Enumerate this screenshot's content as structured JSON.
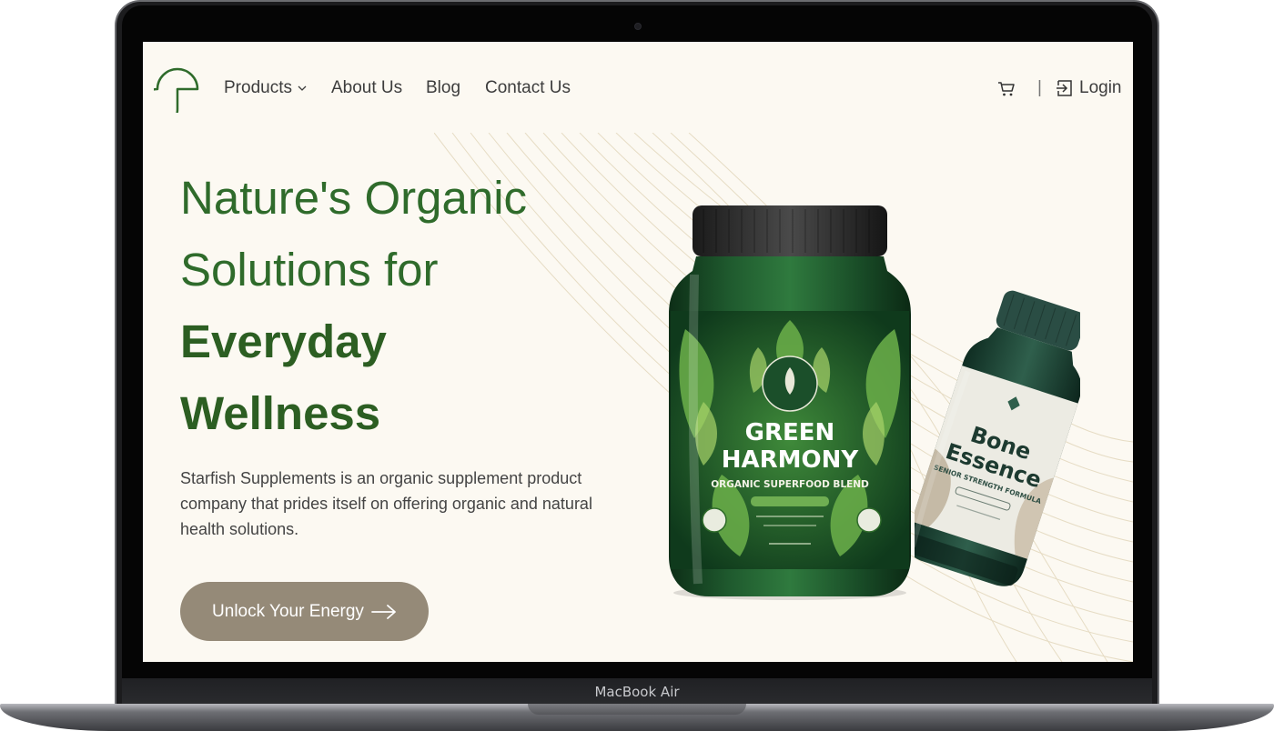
{
  "device": {
    "label": "MacBook Air"
  },
  "nav": {
    "items": [
      {
        "label": "Products",
        "has_dropdown": true
      },
      {
        "label": "About Us"
      },
      {
        "label": "Blog"
      },
      {
        "label": "Contact Us"
      }
    ],
    "divider": "|",
    "login_label": "Login"
  },
  "hero": {
    "title_lines": [
      "Nature's Organic",
      "Solutions for",
      "Everyday",
      "Wellness"
    ],
    "description": "Starfish Supplements is an organic supplement product company that prides itself on offering organic and natural health solutions.",
    "cta_label": "Unlock Your Energy"
  },
  "products": {
    "main": {
      "name_line1": "GREEN",
      "name_line2": "HARMONY",
      "subtitle": "ORGANIC SUPERFOOD BLEND"
    },
    "secondary": {
      "name_line1": "Bone",
      "name_line2": "Essence",
      "subtitle": "SENIOR STRENGTH FORMULA"
    }
  },
  "colors": {
    "background": "#fcf9f2",
    "brand_green": "#2f6b2b",
    "cta": "#958a78"
  }
}
